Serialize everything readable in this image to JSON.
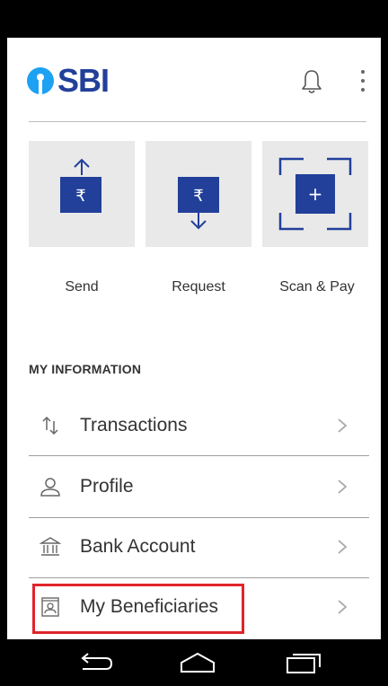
{
  "app": {
    "brand": "SBI",
    "brand_color": "#22409a",
    "logo_color": "#1da1f2"
  },
  "header": {
    "icons": [
      "bell-icon",
      "more-vert-icon"
    ]
  },
  "quick_actions": [
    {
      "id": "send",
      "label": "Send",
      "icon": "rupee-send-icon",
      "glyph": "₹"
    },
    {
      "id": "request",
      "label": "Request",
      "icon": "rupee-request-icon",
      "glyph": "₹"
    },
    {
      "id": "scan",
      "label": "Scan & Pay",
      "icon": "scan-qr-icon",
      "glyph": "+"
    }
  ],
  "my_information": {
    "title": "MY INFORMATION",
    "items": [
      {
        "label": "Transactions",
        "icon": "transactions-arrows-icon"
      },
      {
        "label": "Profile",
        "icon": "user-icon"
      },
      {
        "label": "Bank Account",
        "icon": "bank-icon"
      },
      {
        "label": "My Beneficiaries",
        "icon": "beneficiary-card-icon",
        "highlighted": true
      }
    ]
  },
  "highlight_color": "#e0242b",
  "navbar": {
    "buttons": [
      "back-icon",
      "home-icon",
      "recents-icon"
    ]
  }
}
